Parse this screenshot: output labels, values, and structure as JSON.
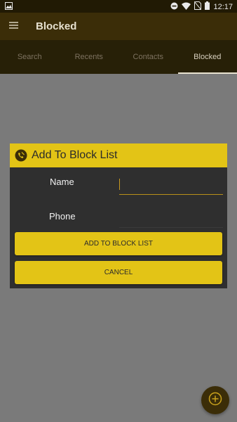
{
  "status_bar": {
    "time": "12:17",
    "icons": [
      "image-icon",
      "dnd-icon",
      "wifi-icon",
      "no-sim-icon",
      "battery-icon"
    ]
  },
  "app_bar": {
    "title": "Blocked",
    "menu_icon": "menu-icon"
  },
  "tabs": [
    {
      "label": "Search",
      "active": false
    },
    {
      "label": "Recents",
      "active": false
    },
    {
      "label": "Contacts",
      "active": false
    },
    {
      "label": "Blocked",
      "active": true
    }
  ],
  "dialog": {
    "title": "Add To Block List",
    "title_icon": "block-icon",
    "fields": {
      "name_label": "Name",
      "name_value": "",
      "phone_label": "Phone",
      "phone_value": ""
    },
    "add_button": "ADD TO BLOCK LIST",
    "cancel_button": "CANCEL"
  },
  "fab": {
    "icon": "add-circle-icon"
  },
  "colors": {
    "accent": "#e3c416",
    "app_bar": "#3b2d08",
    "tab_bar": "#272007",
    "dialog_bg": "#2f2f2f",
    "overlay": "#7a7a7a"
  }
}
